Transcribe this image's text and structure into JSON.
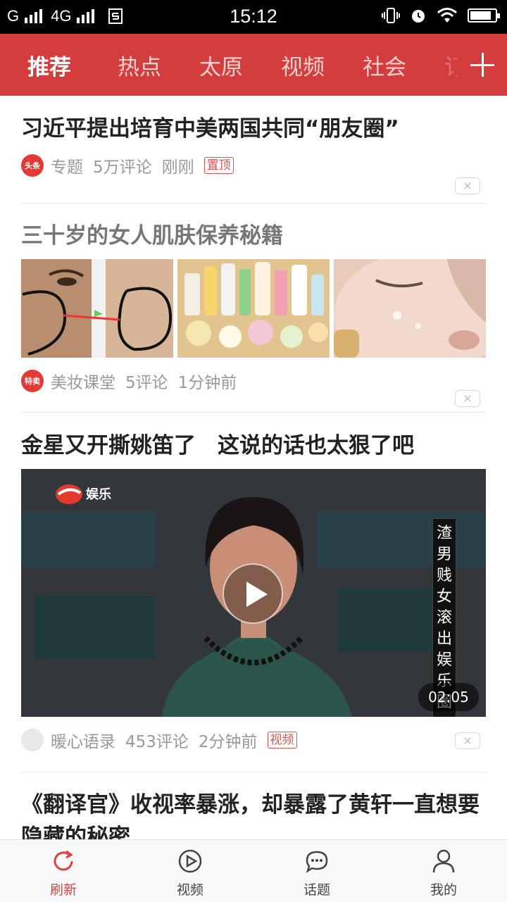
{
  "status_bar": {
    "carrier1": "G",
    "carrier2": "4G",
    "time": "15:12",
    "battery_level": 0.85,
    "icons": [
      "signal-icon",
      "sim-icon",
      "vibrate-icon",
      "alarm-icon",
      "wifi-icon",
      "battery-icon"
    ]
  },
  "top_nav": {
    "tabs": [
      {
        "label": "推荐",
        "active": true
      },
      {
        "label": "热点",
        "active": false
      },
      {
        "label": "太原",
        "active": false
      },
      {
        "label": "视频",
        "active": false
      },
      {
        "label": "社会",
        "active": false
      },
      {
        "label": "订阅",
        "active": false
      }
    ],
    "add_icon": "plus-icon",
    "color": "#d43d3d"
  },
  "feed": [
    {
      "title": "习近平提出培育中美两国共同“朋友圈”",
      "source_icon_text": "头条",
      "source_icon_color": "#e53935",
      "source": "专题",
      "comments": "5万评论",
      "time": "刚刚",
      "tag": "置顶"
    },
    {
      "title": "三十岁的女人肌肤保养秘籍",
      "source_icon_text": "特卖",
      "source_icon_color": "#e53935",
      "source": "美妆课堂",
      "comments": "5评论",
      "time": "1分钟前"
    },
    {
      "title": "金星又开撕姚笛了　这说的话也太狠了吧",
      "source": "暖心语录",
      "comments": "453评论",
      "time": "2分钟前",
      "tag": "视频",
      "video_caption": "渣男贱女滚出娱乐圈",
      "logo_text": "娱乐",
      "duration": "02:05"
    },
    {
      "title": "《翻译官》收视率暴涨，却暴露了黄轩一直想要隐藏的秘密"
    }
  ],
  "bottom_nav": [
    {
      "label": "刷新",
      "icon": "refresh-icon",
      "active": true
    },
    {
      "label": "视频",
      "icon": "video-play-icon",
      "active": false
    },
    {
      "label": "话题",
      "icon": "chat-bubble-icon",
      "active": false
    },
    {
      "label": "我的",
      "icon": "profile-icon",
      "active": false
    }
  ],
  "dismiss_label": "×"
}
